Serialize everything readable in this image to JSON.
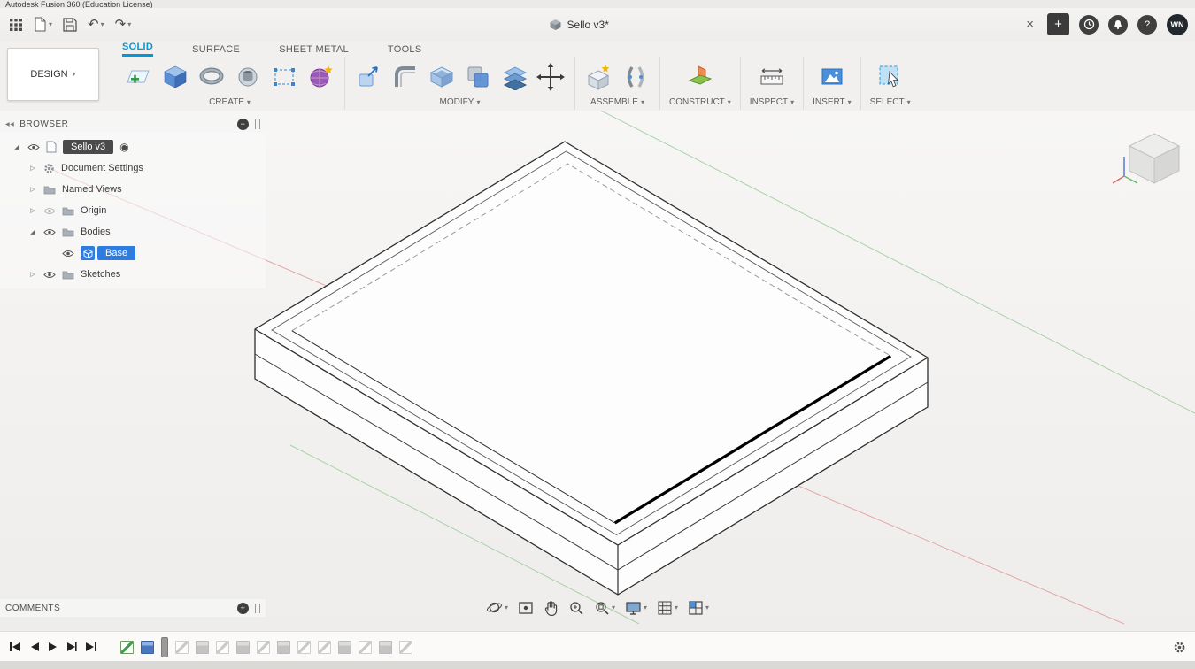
{
  "window": {
    "title": "Autodesk Fusion 360 (Education License)"
  },
  "glyphs": {
    "caret": "▾",
    "undo": "↶",
    "redo": "↷",
    "close": "×",
    "plus": "+",
    "minus": "−",
    "help": "?",
    "radio": "◉",
    "expanded": "◢",
    "collapsed": "▷",
    "panel_collapse": "◀◀"
  },
  "titlebar": {
    "document_title": "Sello v3*",
    "avatar": "WN"
  },
  "ribbon": {
    "workspace_label": "DESIGN",
    "tabs": [
      {
        "label": "SOLID",
        "active": true
      },
      {
        "label": "SURFACE",
        "active": false
      },
      {
        "label": "SHEET METAL",
        "active": false
      },
      {
        "label": "TOOLS",
        "active": false
      }
    ],
    "groups": [
      {
        "label": "CREATE"
      },
      {
        "label": "MODIFY"
      },
      {
        "label": "ASSEMBLE"
      },
      {
        "label": "CONSTRUCT"
      },
      {
        "label": "INSPECT"
      },
      {
        "label": "INSERT"
      },
      {
        "label": "SELECT"
      }
    ]
  },
  "browser": {
    "title": "BROWSER",
    "items": [
      {
        "label": "Sello v3",
        "state": "active-component"
      },
      {
        "label": "Document Settings"
      },
      {
        "label": "Named Views"
      },
      {
        "label": "Origin",
        "visible": false
      },
      {
        "label": "Bodies"
      },
      {
        "label": "Base",
        "state": "selected"
      },
      {
        "label": "Sketches"
      }
    ]
  },
  "comments": {
    "title": "COMMENTS"
  },
  "viewport": {
    "colors": {
      "x_axis": "#e2a9a9",
      "y_axis": "#a9d2a9",
      "selected_edge": "#000000",
      "body_fill": "#fdfdfd",
      "accent": "#0696d7",
      "selection_blue": "#2f7ce0"
    }
  },
  "navbar": {
    "icons": [
      "orbit",
      "look-at",
      "pan",
      "zoom",
      "fit-view",
      "display-settings",
      "grid-settings",
      "viewports"
    ]
  },
  "timeline": {
    "items": [
      {
        "type": "sketch",
        "enabled": true
      },
      {
        "type": "extrude",
        "enabled": true
      },
      {
        "type": "marker"
      },
      {
        "type": "sketch",
        "enabled": false
      },
      {
        "type": "extrude",
        "enabled": false
      },
      {
        "type": "sketch",
        "enabled": false
      },
      {
        "type": "extrude",
        "enabled": false
      },
      {
        "type": "sketch",
        "enabled": false
      },
      {
        "type": "extrude",
        "enabled": false
      },
      {
        "type": "sketch",
        "enabled": false
      },
      {
        "type": "sketch",
        "enabled": false
      },
      {
        "type": "extrude",
        "enabled": false
      },
      {
        "type": "sketch",
        "enabled": false
      },
      {
        "type": "extrude",
        "enabled": false
      },
      {
        "type": "sketch",
        "enabled": false
      }
    ]
  }
}
